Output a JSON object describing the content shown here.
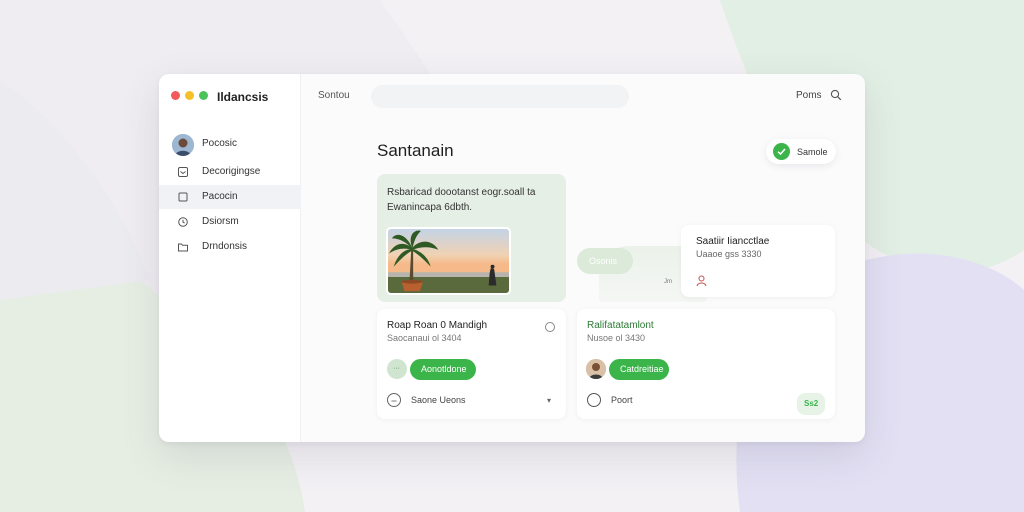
{
  "app": {
    "title": "Ildancsis"
  },
  "toolbar": {
    "left_label": "Sontou",
    "right_label": "Poms"
  },
  "sidebar": {
    "items": [
      {
        "label": "Pocosic"
      },
      {
        "label": "Decorigingse"
      },
      {
        "label": "Pacocin"
      },
      {
        "label": "Dsiorsm"
      },
      {
        "label": "Drndonsis"
      }
    ]
  },
  "main": {
    "title": "Santanain",
    "status_pill": "Samole",
    "feature": {
      "line1": "Rsbaricad doootanst eogr.soall   ta",
      "line2": "Ewanincapa 6dbth."
    },
    "float_pill": "Osonis",
    "info": {
      "title": "Saatiir Iiancctlae",
      "sub": "Uaaoe gss 3330",
      "tag": "Jm"
    },
    "card_left": {
      "title": "Roap Roan 0 Mandigh",
      "sub": "Saocanaui ol 3404",
      "avatar_text": "···",
      "button": "Aonotldone",
      "footer": "Saone Ueons"
    },
    "card_right": {
      "title": "Ralifatatamlont",
      "sub": "Nusoe ol 3430",
      "button": "Catdreitiae",
      "footer": "Poort",
      "badge": "Ss2"
    }
  },
  "colors": {
    "accent": "#3bb54a",
    "close": "#f05a5a",
    "minimize": "#f5c02a",
    "maximize": "#4cc25a"
  }
}
